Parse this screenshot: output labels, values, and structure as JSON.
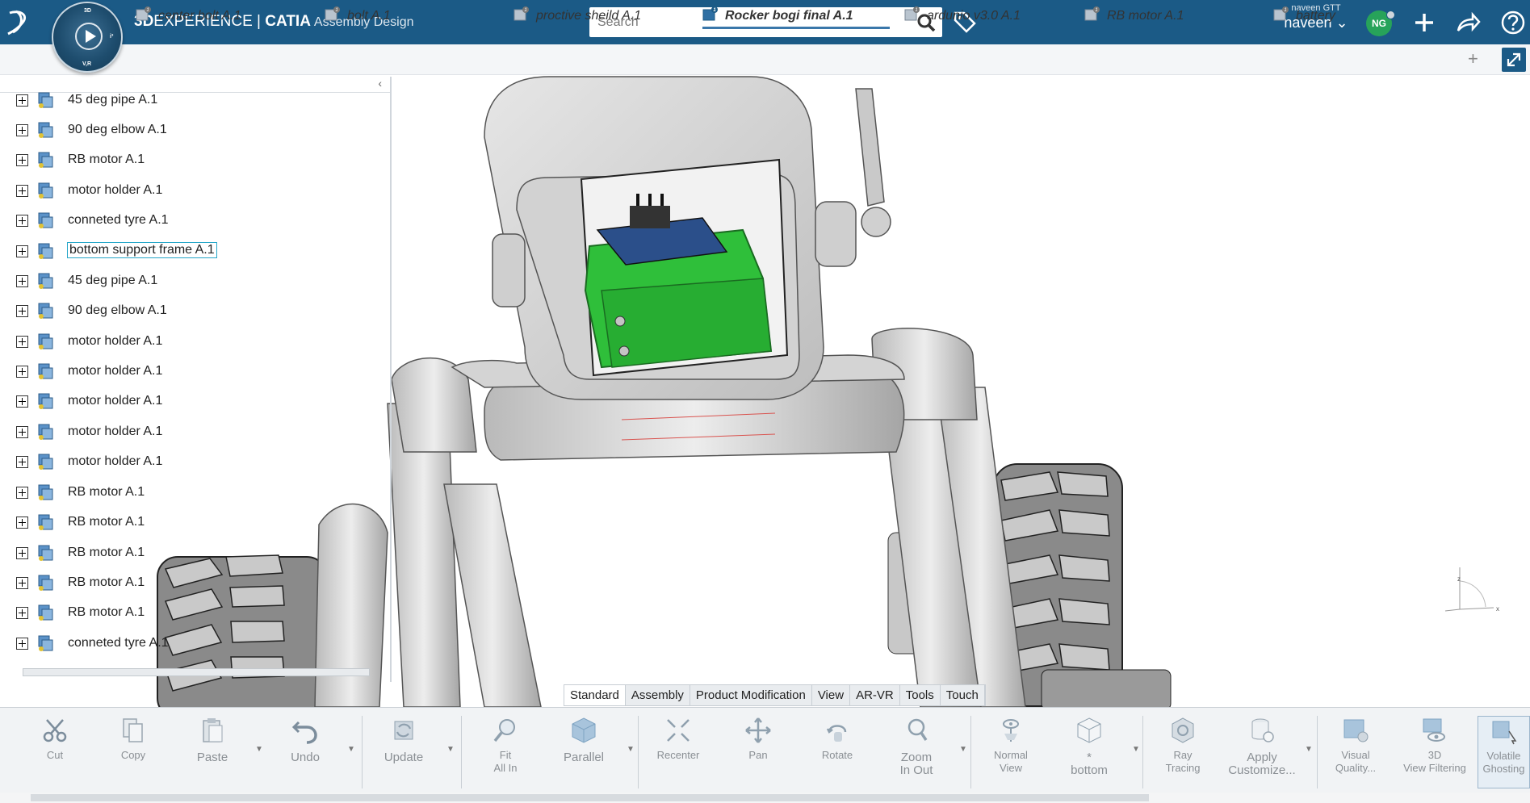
{
  "header": {
    "brand_bold": "3D",
    "brand_main": "EXPERIENCE",
    "brand_sep": " | ",
    "brand_app": "CATIA",
    "brand_sub": "Assembly Design",
    "compass": {
      "top": "3D",
      "right": "i³",
      "bottom": "V,R"
    },
    "search_placeholder": "Search",
    "user_company": "naveen GTT",
    "user_name": "naveen",
    "avatar_initials": "NG"
  },
  "tabs": [
    {
      "label": "center bolt A.1",
      "badge": "1",
      "active": false
    },
    {
      "label": "bolt A.1",
      "badge": "1",
      "active": false
    },
    {
      "label": "proctive sheild A.1",
      "badge": "1",
      "active": false
    },
    {
      "label": "Rocker bogi final A.1",
      "badge": "1",
      "active": true
    },
    {
      "label": "ardunio v3.0 A.1",
      "badge": "1",
      "active": false
    },
    {
      "label": "RB motor A.1",
      "badge": "1",
      "active": false
    },
    {
      "label": "battery",
      "badge": "1",
      "active": false
    }
  ],
  "tree": {
    "collapse_glyph": "‹",
    "items": [
      {
        "label": "45 deg pipe A.1"
      },
      {
        "label": "90 deg elbow A.1"
      },
      {
        "label": "RB motor A.1"
      },
      {
        "label": "motor holder A.1"
      },
      {
        "label": "conneted tyre A.1"
      },
      {
        "label": "bottom support frame A.1",
        "selected": true
      },
      {
        "label": "45 deg pipe A.1"
      },
      {
        "label": "90 deg elbow A.1"
      },
      {
        "label": "motor holder A.1"
      },
      {
        "label": "motor holder A.1"
      },
      {
        "label": "motor holder A.1"
      },
      {
        "label": "motor holder A.1"
      },
      {
        "label": "motor holder A.1"
      },
      {
        "label": "RB motor A.1"
      },
      {
        "label": "RB motor A.1"
      },
      {
        "label": "RB motor A.1"
      },
      {
        "label": "RB motor A.1"
      },
      {
        "label": "RB motor A.1"
      },
      {
        "label": "conneted tyre A.1"
      }
    ]
  },
  "section_tabs": [
    {
      "label": "Standard",
      "active": true
    },
    {
      "label": "Assembly",
      "active": false
    },
    {
      "label": "Product Modification",
      "active": false
    },
    {
      "label": "View",
      "active": false
    },
    {
      "label": "AR-VR",
      "active": false
    },
    {
      "label": "Tools",
      "active": false
    },
    {
      "label": "Touch",
      "active": false
    }
  ],
  "actions": {
    "cut": "Cut",
    "copy": "Copy",
    "paste": "Paste",
    "undo": "Undo",
    "update": "Update",
    "fit_all_in_1": "Fit",
    "fit_all_in_2": "All In",
    "parallel": "Parallel",
    "recenter": "Recenter",
    "pan": "Pan",
    "rotate": "Rotate",
    "zoom_1": "Zoom",
    "zoom_2": "In Out",
    "normal_view_1": "Normal",
    "normal_view_2": "View",
    "bottom_1": "*",
    "bottom_2": "bottom",
    "ray_tracing_1": "Ray",
    "ray_tracing_2": "Tracing",
    "apply_custom_1": "Apply",
    "apply_custom_2": "Customize...",
    "visual_quality_1": "Visual",
    "visual_quality_2": "Quality...",
    "view_filtering_1": "3D",
    "view_filtering_2": "View Filtering",
    "volatile_1": "Volatile",
    "volatile_2": "Ghosting"
  },
  "axis_labels": {
    "x": "x",
    "z": "z"
  },
  "colors": {
    "topbar": "#1b5a86",
    "accent": "#3a77aa",
    "selected_outline": "#25a6c8",
    "avatar": "#27a35a",
    "highlight_part": "#2fbf3a"
  }
}
